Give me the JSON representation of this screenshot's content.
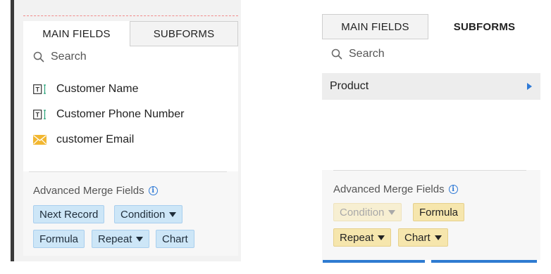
{
  "left_panel": {
    "tabs": [
      {
        "label": "MAIN FIELDS",
        "active": true
      },
      {
        "label": "SUBFORMS",
        "active": false
      }
    ],
    "search": {
      "placeholder": "Search"
    },
    "fields": [
      {
        "label": "Customer Name",
        "icon": "text-field-icon"
      },
      {
        "label": "Customer Phone Number",
        "icon": "text-field-icon"
      },
      {
        "label": "customer Email",
        "icon": "email-icon"
      }
    ],
    "advanced": {
      "title": "Advanced Merge Fields",
      "chips": [
        {
          "label": "Next Record",
          "dropdown": false
        },
        {
          "label": "Condition",
          "dropdown": true
        },
        {
          "label": "Formula",
          "dropdown": false
        },
        {
          "label": "Repeat",
          "dropdown": true
        },
        {
          "label": "Chart",
          "dropdown": false
        }
      ]
    }
  },
  "right_panel": {
    "tabs": [
      {
        "label": "MAIN FIELDS",
        "active": false
      },
      {
        "label": "SUBFORMS",
        "active": true
      }
    ],
    "search": {
      "placeholder": "Search"
    },
    "subforms": [
      {
        "label": "Product"
      }
    ],
    "advanced": {
      "title": "Advanced Merge Fields",
      "chips": [
        {
          "label": "Condition",
          "dropdown": true,
          "disabled": true
        },
        {
          "label": "Formula",
          "dropdown": false,
          "disabled": false
        },
        {
          "label": "Repeat",
          "dropdown": true,
          "disabled": false
        },
        {
          "label": "Chart",
          "dropdown": true,
          "disabled": false
        }
      ]
    }
  },
  "colors": {
    "accent_blue": "#2f7ad6",
    "chip_blue": "#cde6f7",
    "chip_yellow": "#f6e6ad",
    "email_icon": "#f2b731"
  }
}
